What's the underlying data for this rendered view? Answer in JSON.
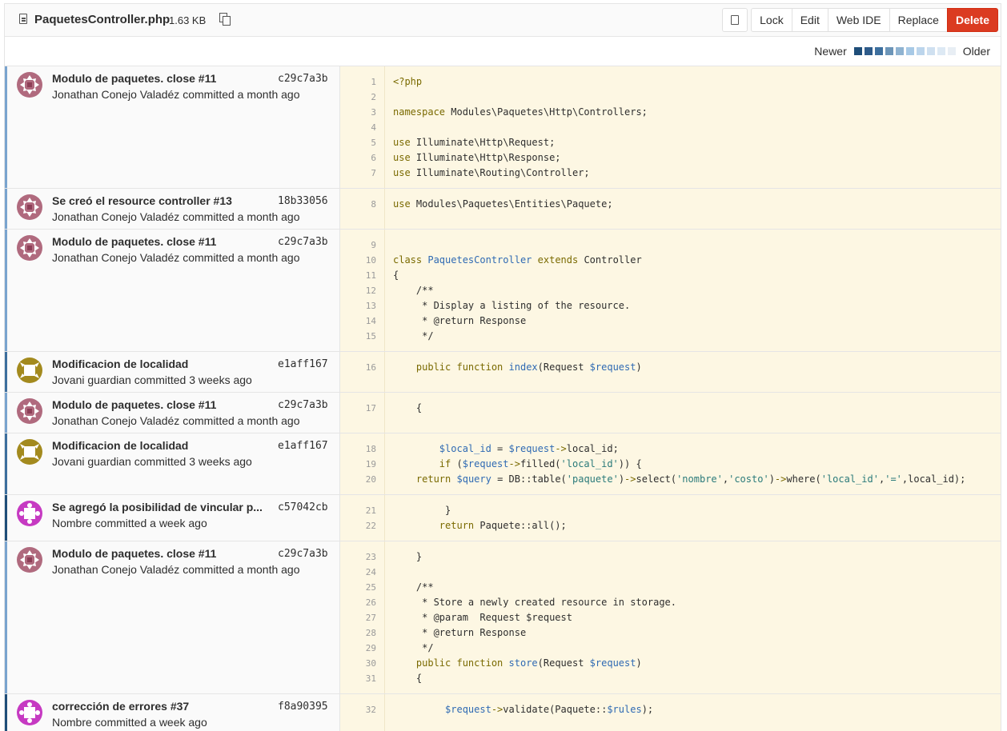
{
  "file": {
    "name": "PaquetesController.php",
    "size": "1.63 KB"
  },
  "buttons": {
    "lock": "Lock",
    "edit": "Edit",
    "web_ide": "Web IDE",
    "replace": "Replace",
    "delete": "Delete"
  },
  "legend": {
    "newer": "Newer",
    "older": "Older",
    "colors": [
      "#1f4e79",
      "#2e5b8a",
      "#3d6f9e",
      "#6c95b8",
      "#8fb3d1",
      "#a7c9e6",
      "#bcd5ec",
      "#cfe0f0",
      "#dde9f4",
      "#e8eef4"
    ]
  },
  "colors": {
    "keyword": "#7a6a00",
    "string": "#2a7a7a",
    "variable": "#2f6ab3",
    "comment": "#2e2e2e",
    "funcname": "#2f6ab3"
  },
  "blame": [
    {
      "title": "Modulo de paquetes. close #11",
      "sha": "c29c7a3b",
      "author": "Jonathan Conejo Valadéz",
      "when": "committed a month ago",
      "avatar": "avatar-jonathan",
      "age": "#7aa4cf",
      "lines": [
        "1",
        "2",
        "3",
        "4",
        "5",
        "6",
        "7"
      ],
      "code": [
        [
          [
            "k",
            "<?php"
          ]
        ],
        [],
        [
          [
            "k",
            "namespace"
          ],
          [
            "p",
            " Modules\\Paquetes\\Http\\Controllers;"
          ]
        ],
        [],
        [
          [
            "k",
            "use"
          ],
          [
            "p",
            " Illuminate\\Http\\Request;"
          ]
        ],
        [
          [
            "k",
            "use"
          ],
          [
            "p",
            " Illuminate\\Http\\Response;"
          ]
        ],
        [
          [
            "k",
            "use"
          ],
          [
            "p",
            " Illuminate\\Routing\\Controller;"
          ]
        ]
      ]
    },
    {
      "title": "Se creó el resource controller #13",
      "sha": "18b33056",
      "author": "Jonathan Conejo Valadéz",
      "when": "committed a month ago",
      "avatar": "avatar-jonathan",
      "age": "#7aa4cf",
      "lines": [
        "8"
      ],
      "code": [
        [
          [
            "k",
            "use"
          ],
          [
            "p",
            " Modules\\Paquetes\\Entities\\Paquete;"
          ]
        ]
      ]
    },
    {
      "title": "Modulo de paquetes. close #11",
      "sha": "c29c7a3b",
      "author": "Jonathan Conejo Valadéz",
      "when": "committed a month ago",
      "avatar": "avatar-jonathan",
      "age": "#7aa4cf",
      "lines": [
        "9",
        "10",
        "11",
        "12",
        "13",
        "14",
        "15"
      ],
      "code": [
        [],
        [
          [
            "k",
            "class"
          ],
          [
            "p",
            " "
          ],
          [
            "f",
            "PaquetesController"
          ],
          [
            "p",
            " "
          ],
          [
            "k",
            "extends"
          ],
          [
            "p",
            " Controller"
          ]
        ],
        [
          [
            "p",
            "{"
          ]
        ],
        [
          [
            "c",
            "    /**"
          ]
        ],
        [
          [
            "c",
            "     * Display a listing of the resource."
          ]
        ],
        [
          [
            "c",
            "     * @return Response"
          ]
        ],
        [
          [
            "c",
            "     */"
          ]
        ]
      ]
    },
    {
      "title": "Modificacion de localidad",
      "sha": "e1aff167",
      "author": "Jovani guardian",
      "when": "committed 3 weeks ago",
      "avatar": "avatar-jovani",
      "age": "#3d6f9e",
      "lines": [
        "16"
      ],
      "code": [
        [
          [
            "p",
            "    "
          ],
          [
            "k",
            "public function"
          ],
          [
            "p",
            " "
          ],
          [
            "f",
            "index"
          ],
          [
            "p",
            "(Request "
          ],
          [
            "v",
            "$request"
          ],
          [
            "p",
            ")"
          ]
        ]
      ]
    },
    {
      "title": "Modulo de paquetes. close #11",
      "sha": "c29c7a3b",
      "author": "Jonathan Conejo Valadéz",
      "when": "committed a month ago",
      "avatar": "avatar-jonathan",
      "age": "#7aa4cf",
      "lines": [
        "17"
      ],
      "code": [
        [
          [
            "p",
            "    {"
          ]
        ]
      ]
    },
    {
      "title": "Modificacion de localidad",
      "sha": "e1aff167",
      "author": "Jovani guardian",
      "when": "committed 3 weeks ago",
      "avatar": "avatar-jovani",
      "age": "#3d6f9e",
      "lines": [
        "18",
        "19",
        "20"
      ],
      "code": [
        [
          [
            "p",
            "        "
          ],
          [
            "v",
            "$local_id"
          ],
          [
            "p",
            " = "
          ],
          [
            "v",
            "$request"
          ],
          [
            "k",
            "->"
          ],
          [
            "p",
            "local_id;"
          ]
        ],
        [
          [
            "p",
            "        "
          ],
          [
            "k",
            "if"
          ],
          [
            "p",
            " ("
          ],
          [
            "v",
            "$request"
          ],
          [
            "k",
            "->"
          ],
          [
            "p",
            "filled("
          ],
          [
            "s",
            "'local_id'"
          ],
          [
            "p",
            ")) {"
          ]
        ],
        [
          [
            "p",
            "    "
          ],
          [
            "k",
            "return"
          ],
          [
            "p",
            " "
          ],
          [
            "v",
            "$query"
          ],
          [
            "p",
            " = DB::table("
          ],
          [
            "s",
            "'paquete'"
          ],
          [
            "p",
            ")"
          ],
          [
            "k",
            "->"
          ],
          [
            "p",
            "select("
          ],
          [
            "s",
            "'nombre'"
          ],
          [
            "p",
            ","
          ],
          [
            "s",
            "'costo'"
          ],
          [
            "p",
            ")"
          ],
          [
            "k",
            "->"
          ],
          [
            "p",
            "where("
          ],
          [
            "s",
            "'local_id'"
          ],
          [
            "p",
            ","
          ],
          [
            "s",
            "'='"
          ],
          [
            "p",
            ",local_id);"
          ]
        ]
      ]
    },
    {
      "title": "Se agregó la posibilidad de vincular p...",
      "sha": "c57042cb",
      "author": "Nombre",
      "when": "committed a week ago",
      "avatar": "avatar-nombre",
      "age": "#1f4e79",
      "lines": [
        "21",
        "22"
      ],
      "code": [
        [
          [
            "p",
            "         }"
          ]
        ],
        [
          [
            "p",
            "        "
          ],
          [
            "k",
            "return"
          ],
          [
            "p",
            " Paquete::all();"
          ]
        ]
      ]
    },
    {
      "title": "Modulo de paquetes. close #11",
      "sha": "c29c7a3b",
      "author": "Jonathan Conejo Valadéz",
      "when": "committed a month ago",
      "avatar": "avatar-jonathan",
      "age": "#7aa4cf",
      "lines": [
        "23",
        "24",
        "25",
        "26",
        "27",
        "28",
        "29",
        "30",
        "31"
      ],
      "code": [
        [
          [
            "p",
            "    }"
          ]
        ],
        [],
        [
          [
            "c",
            "    /**"
          ]
        ],
        [
          [
            "c",
            "     * Store a newly created resource in storage."
          ]
        ],
        [
          [
            "c",
            "     * @param  Request $request"
          ]
        ],
        [
          [
            "c",
            "     * @return Response"
          ]
        ],
        [
          [
            "c",
            "     */"
          ]
        ],
        [
          [
            "p",
            "    "
          ],
          [
            "k",
            "public function"
          ],
          [
            "p",
            " "
          ],
          [
            "f",
            "store"
          ],
          [
            "p",
            "(Request "
          ],
          [
            "v",
            "$request"
          ],
          [
            "p",
            ")"
          ]
        ],
        [
          [
            "p",
            "    {"
          ]
        ]
      ]
    },
    {
      "title": "corrección de errores #37",
      "sha": "f8a90395",
      "author": "Nombre",
      "when": "committed a week ago",
      "avatar": "avatar-nombre",
      "age": "#1f4e79",
      "lines": [
        "32"
      ],
      "code": [
        [
          [
            "p",
            "         "
          ],
          [
            "v",
            "$request"
          ],
          [
            "k",
            "->"
          ],
          [
            "p",
            "validate(Paquete::"
          ],
          [
            "v",
            "$rules"
          ],
          [
            "p",
            ");"
          ]
        ]
      ]
    }
  ]
}
